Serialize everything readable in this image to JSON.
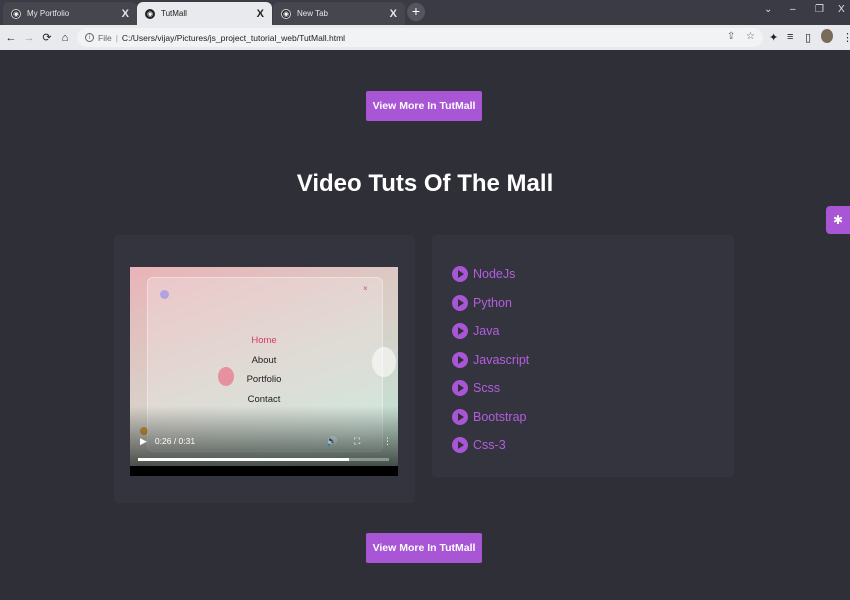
{
  "browser": {
    "tabs": [
      {
        "title": "My Portfolio",
        "state": "inactive"
      },
      {
        "title": "TutMall",
        "state": "active"
      },
      {
        "title": "New Tab",
        "state": "inactive"
      }
    ],
    "new_tab_glyph": "+",
    "close_glyph": "X",
    "address": {
      "scheme_label": "File",
      "url": "C:/Users/vijay/Pictures/js_project_tutorial_web/TutMall.html"
    },
    "window_controls": {
      "minimize": "–",
      "restore": "❐",
      "close": "X",
      "search_tabs": "⌄"
    }
  },
  "page": {
    "top_button": "View More In TutMall",
    "section_title": "Video Tuts Of The Mall",
    "bottom_button": "View More In TutMall",
    "video": {
      "menu": [
        "Home",
        "About",
        "Portfolio",
        "Contact"
      ],
      "time": "0:26 / 0:31",
      "progress": 0.84
    },
    "list": [
      "NodeJs",
      "Python",
      "Java",
      "Javascript",
      "Scss",
      "Bootstrap",
      "Css-3"
    ],
    "colors": {
      "accent": "#a855d6",
      "background": "#2f2f37",
      "card": "#34343e"
    }
  }
}
